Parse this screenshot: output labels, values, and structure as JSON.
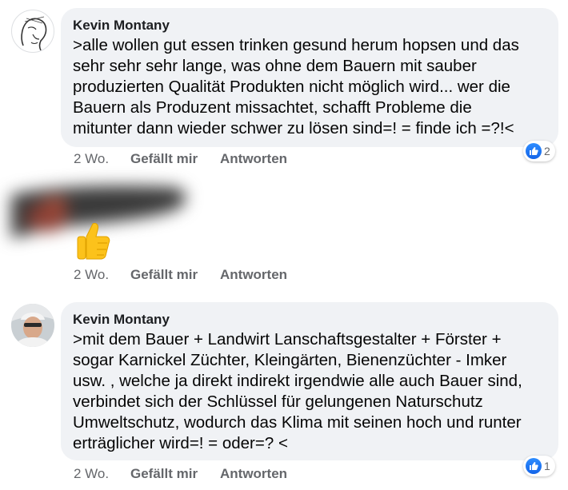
{
  "comments": [
    {
      "author": "Kevin Montany",
      "lines": [
        ">alle wollen gut  essen trinken gesund herum hopsen und das",
        "sehr sehr sehr lange, was ohne dem Bauern mit  sauber",
        "produzierten Qualität Produkten nicht möglich wird... wer die",
        "Bauern als Produzent missachtet, schafft Probleme die",
        "mitunter dann wieder  schwer zu lösen sind=! = finde ich =?!<"
      ],
      "time": "2 Wo.",
      "like_label": "Gefällt mir",
      "reply_label": "Antworten",
      "reaction_count": "2"
    },
    {
      "time": "2 Wo.",
      "like_label": "Gefällt mir",
      "reply_label": "Antworten"
    },
    {
      "author": "Kevin Montany",
      "lines": [
        ">mit dem Bauer + Landwirt Lanschaftsgestalter + Förster +",
        "sogar Karnickel Züchter, Kleingärten, Bienenzüchter - Imker",
        "usw. , welche ja direkt indirekt irgendwie alle auch Bauer  sind,",
        "verbindet sich der Schlüssel für gelungenen Naturschutz",
        "Umweltschutz, wodurch das Klima mit seinen hoch und runter",
        "erträglicher wird=! = oder=? <"
      ],
      "time": "2 Wo.",
      "like_label": "Gefällt mir",
      "reply_label": "Antworten",
      "reaction_count": "1"
    }
  ],
  "colors": {
    "bubble": "#f0f2f5",
    "meta_text": "#65676b",
    "like_blue": "#1877f2",
    "thumb_yellow": "#fcc21b"
  },
  "icons": [
    "sketch-face-avatar",
    "photo-avatar",
    "like-icon",
    "thumbs-up-emoji"
  ]
}
